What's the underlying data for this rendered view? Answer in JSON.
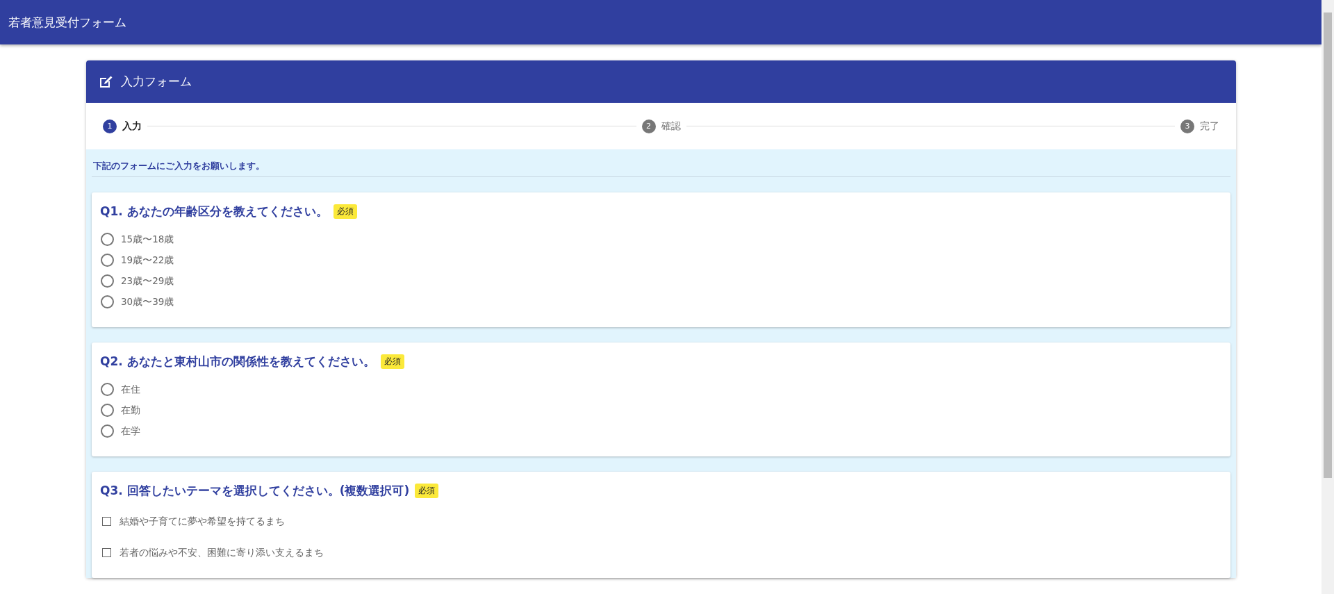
{
  "app_bar": {
    "title": "若者意見受付フォーム"
  },
  "card": {
    "title": "入力フォーム",
    "steps": [
      {
        "number": "1",
        "label": "入力",
        "selected": true
      },
      {
        "number": "2",
        "label": "確認",
        "selected": false
      },
      {
        "number": "3",
        "label": "完了",
        "selected": false
      }
    ],
    "intro": "下記のフォームにご入力をお願いします。",
    "questions": [
      {
        "kind": "radio",
        "title": "Q1. あなたの年齢区分を教えてください。",
        "badge": "必須",
        "options": [
          {
            "label": "15歳〜18歳",
            "checked": false
          },
          {
            "label": "19歳〜22歳",
            "checked": false
          },
          {
            "label": "23歳〜29歳",
            "checked": false
          },
          {
            "label": "30歳〜39歳",
            "checked": false
          }
        ]
      },
      {
        "kind": "radio",
        "title": "Q2. あなたと東村山市の関係性を教えてください。",
        "badge": "必須",
        "options": [
          {
            "label": "在住",
            "checked": false
          },
          {
            "label": "在勤",
            "checked": false
          },
          {
            "label": "在学",
            "checked": false
          }
        ]
      },
      {
        "kind": "checkbox",
        "title": "Q3. 回答したいテーマを選択してください。(複数選択可)",
        "badge": "必須",
        "options": [
          {
            "label": "結婚や子育てに夢や希望を持てるまち",
            "checked": false
          },
          {
            "label": "若者の悩みや不安、困難に寄り添い支えるまち",
            "checked": false
          }
        ]
      }
    ]
  }
}
